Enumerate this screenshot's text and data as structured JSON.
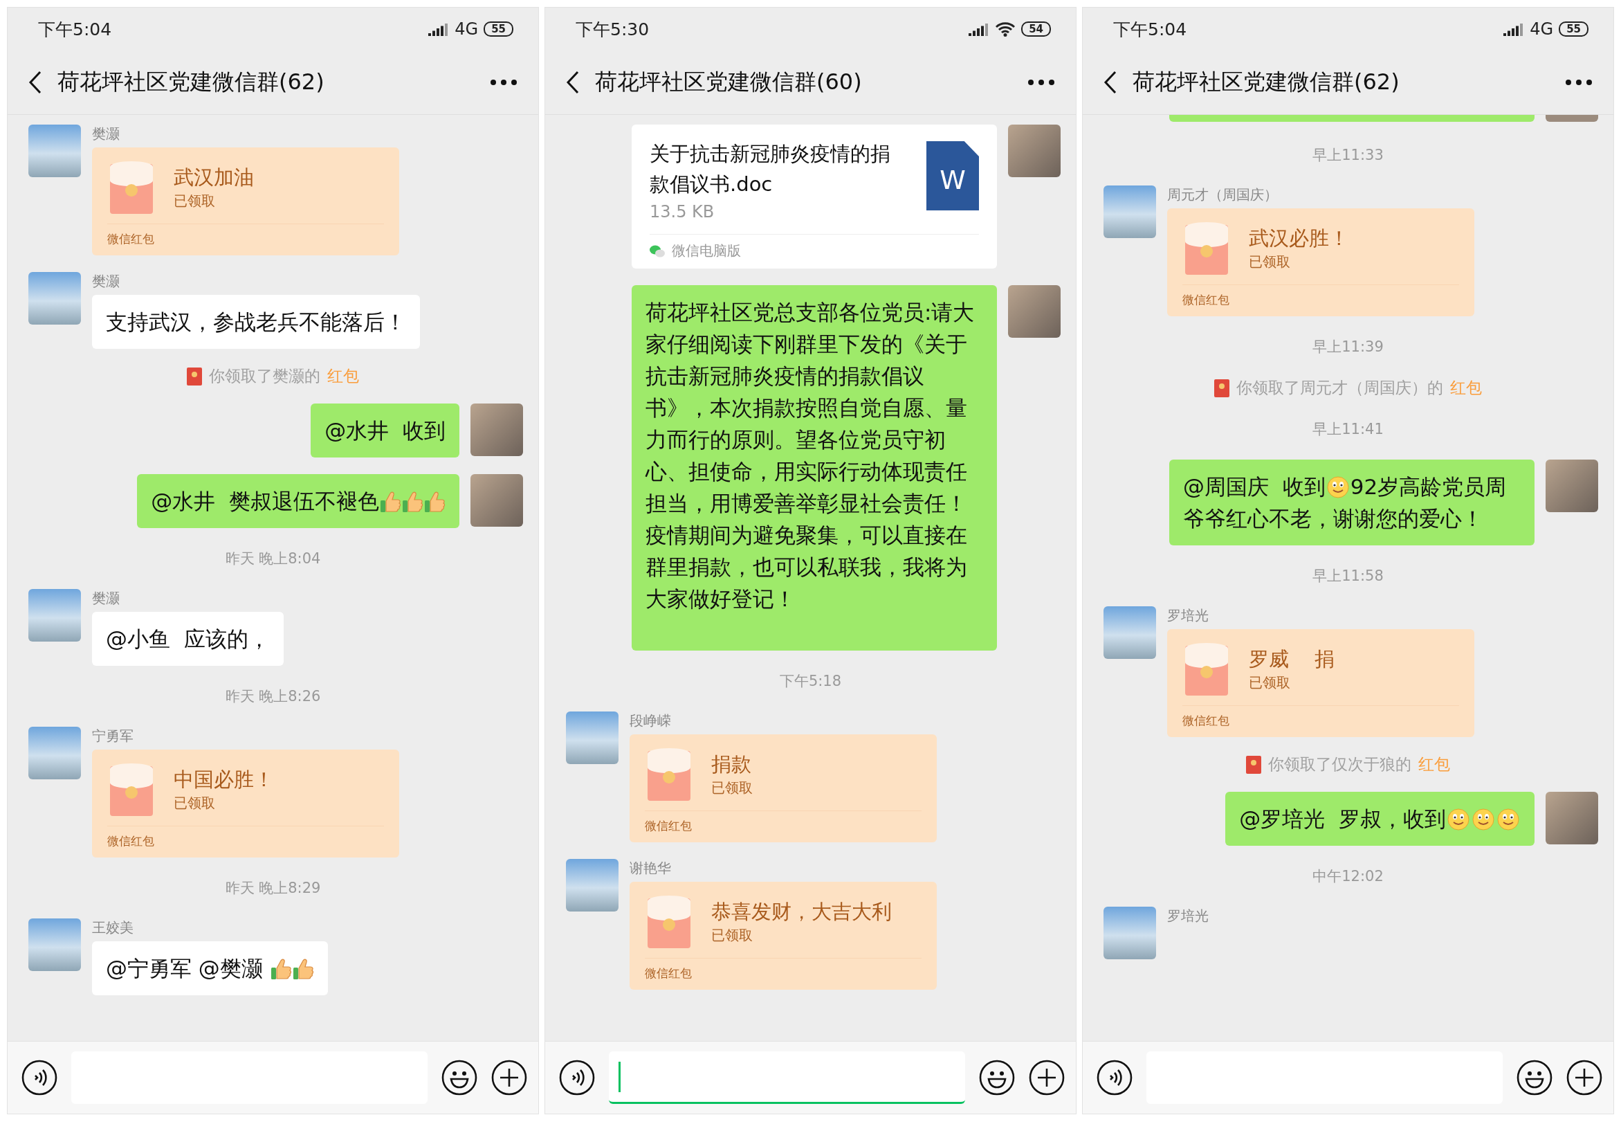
{
  "phones": [
    {
      "status_bar": {
        "time": "下午5:04",
        "connection": {
          "kind": "cellular",
          "label": "4G"
        },
        "battery": "55"
      },
      "header": {
        "title": "荷花坪社区党建微信群(62)"
      },
      "input": {
        "focused": false
      },
      "messages": [
        {
          "kind": "packet",
          "outgoing": false,
          "sender": "樊灏",
          "title": "武汉加油",
          "status": "已领取",
          "footer": "微信红包",
          "claimed": true
        },
        {
          "kind": "text",
          "outgoing": false,
          "sender": "樊灏",
          "parts": [
            {
              "kind": "text",
              "text": "支持武汉，参战老兵不能落后！"
            }
          ]
        },
        {
          "kind": "notice",
          "text": "你领取了樊灏的",
          "link": "红包"
        },
        {
          "kind": "text",
          "outgoing": true,
          "parts": [
            {
              "kind": "text",
              "text": "@水井  收到"
            }
          ]
        },
        {
          "kind": "text",
          "outgoing": true,
          "parts": [
            {
              "kind": "text",
              "text": "@水井  樊叔退伍不褪色"
            },
            {
              "kind": "thumbs_up"
            },
            {
              "kind": "thumbs_up"
            },
            {
              "kind": "thumbs_up"
            }
          ]
        },
        {
          "kind": "time",
          "text": "昨天 晚上8:04"
        },
        {
          "kind": "text",
          "outgoing": false,
          "sender": "樊灏",
          "parts": [
            {
              "kind": "text",
              "text": "@小鱼  应该的，"
            }
          ]
        },
        {
          "kind": "time",
          "text": "昨天 晚上8:26"
        },
        {
          "kind": "packet",
          "outgoing": false,
          "sender": "宁勇军",
          "title": "中国必胜！",
          "status": "已领取",
          "footer": "微信红包",
          "claimed": true
        },
        {
          "kind": "time",
          "text": "昨天 晚上8:29"
        },
        {
          "kind": "text",
          "outgoing": false,
          "sender": "王姣美",
          "parts": [
            {
              "kind": "text",
              "text": "@宁勇军 @樊灏 "
            },
            {
              "kind": "thumbs_up"
            },
            {
              "kind": "thumbs_up"
            }
          ]
        }
      ]
    },
    {
      "status_bar": {
        "time": "下午5:30",
        "connection": {
          "kind": "wifi"
        },
        "battery": "54"
      },
      "header": {
        "title": "荷花坪社区党建微信群(60)"
      },
      "input": {
        "focused": true
      },
      "messages": [
        {
          "kind": "file",
          "outgoing": true,
          "name": "关于抗击新冠肺炎疫情的捐款倡议书.doc",
          "size": "13.5 KB",
          "source": "微信电脑版",
          "type_letter": "W"
        },
        {
          "kind": "text",
          "outgoing": true,
          "parts": [
            {
              "kind": "text",
              "text": "荷花坪社区党总支部各位党员:请大家仔细阅读下刚群里下发的《关于抗击新冠肺炎疫情的捐款倡议书》，本次捐款按照自觉自愿、量力而行的原则。望各位党员守初心、担使命，用实际行动体现责任担当，用博爱善举彰显社会责任！疫情期间为避免聚集，可以直接在群里捐款，也可以私联我，我将为大家做好登记！"
            }
          ]
        },
        {
          "kind": "time",
          "text": "下午5:18"
        },
        {
          "kind": "packet",
          "outgoing": false,
          "sender": "段峥嵘",
          "title": "捐款",
          "status": "已领取",
          "footer": "微信红包",
          "claimed": true
        },
        {
          "kind": "packet",
          "outgoing": false,
          "sender": "谢艳华",
          "title": "恭喜发财，大吉大利",
          "status": "已领取",
          "footer": "微信红包",
          "claimed": true
        }
      ]
    },
    {
      "status_bar": {
        "time": "下午5:04",
        "connection": {
          "kind": "cellular",
          "label": "4G"
        },
        "battery": "55"
      },
      "header": {
        "title": "荷花坪社区党建微信群(62)"
      },
      "input": {
        "focused": false
      },
      "messages": [
        {
          "kind": "clipped",
          "outgoing": true
        },
        {
          "kind": "time",
          "text": "早上11:33"
        },
        {
          "kind": "packet",
          "outgoing": false,
          "sender": "周元才（周国庆）",
          "title": "武汉必胜！",
          "status": "已领取",
          "footer": "微信红包",
          "claimed": true
        },
        {
          "kind": "time",
          "text": "早上11:39"
        },
        {
          "kind": "notice",
          "text": "你领取了周元才（周国庆）的",
          "link": "红包"
        },
        {
          "kind": "time",
          "text": "早上11:41"
        },
        {
          "kind": "text",
          "outgoing": true,
          "parts": [
            {
              "kind": "text",
              "text": "@周国庆  收到"
            },
            {
              "kind": "smile"
            },
            {
              "kind": "text",
              "text": "92岁高龄党员周"
            },
            {
              "kind": "text",
              "text": "爷爷红心不老，谢谢您的爱心！"
            }
          ]
        },
        {
          "kind": "time",
          "text": "早上11:58"
        },
        {
          "kind": "packet",
          "outgoing": false,
          "sender": "罗培光",
          "title": "罗威    捐",
          "status": "已领取",
          "footer": "微信红包",
          "claimed": true
        },
        {
          "kind": "notice",
          "text": "你领取了仅次于狼的",
          "link": "红包"
        },
        {
          "kind": "text",
          "outgoing": true,
          "parts": [
            {
              "kind": "text",
              "text": "@罗培光  罗叔，收到"
            },
            {
              "kind": "smile"
            },
            {
              "kind": "smile"
            },
            {
              "kind": "smile"
            }
          ]
        },
        {
          "kind": "time",
          "text": "中午12:02"
        },
        {
          "kind": "clipped",
          "outgoing": false,
          "sender": "罗培光"
        }
      ]
    }
  ]
}
